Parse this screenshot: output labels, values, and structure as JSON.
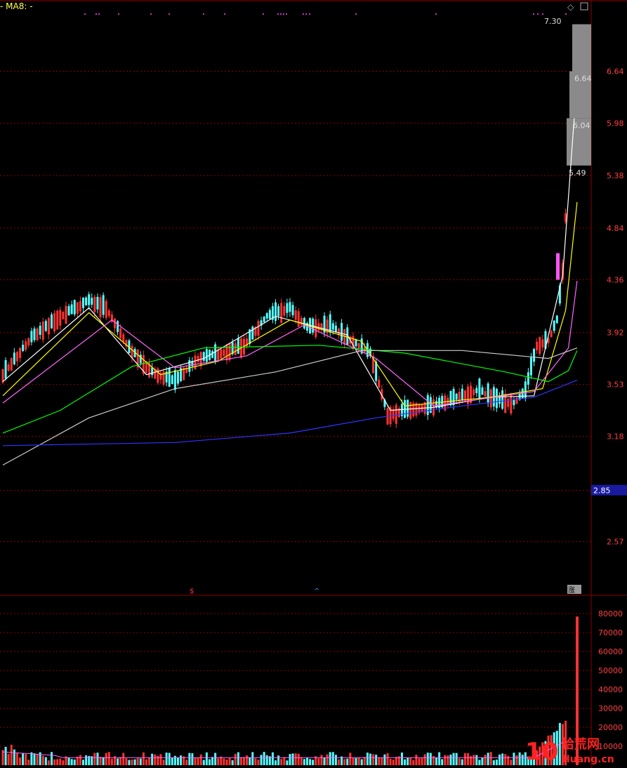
{
  "header": {
    "ma_label": "MA8:",
    "ma_value": "-",
    "left_mark": "-"
  },
  "icons": [
    "diamond-icon",
    "window-icon"
  ],
  "colors": {
    "background": "#000000",
    "up": "#ff3232",
    "down": "#54ffff",
    "grid": "#8b0000",
    "ma5": "#ffffff",
    "ma10": "#ffff00",
    "ma20": "#ff66ff",
    "ma60": "#00ff00",
    "ma120": "#cccccc",
    "ma250": "#3333ff",
    "axis_text": "#ff4040"
  },
  "chart_data": {
    "type": "candlestick",
    "price_axis": {
      "ticks": [
        "6.64",
        "5.98",
        "5.38",
        "4.84",
        "4.36",
        "3.92",
        "3.53",
        "3.18",
        "2.85",
        "2.57"
      ],
      "ylim": [
        2.4,
        7.4
      ],
      "scale": "log"
    },
    "price_tags": [
      "7.30",
      "6.64",
      "6.04",
      "5.49"
    ],
    "current_price_tag": "2.85",
    "markers": [
      "$",
      "^",
      "涨"
    ],
    "volume_axis": {
      "ticks": [
        "80000",
        "70000",
        "60000",
        "50000",
        "40000",
        "30000",
        "20000",
        "10000"
      ],
      "ylim": [
        0,
        86000
      ]
    },
    "watermark": {
      "brand": "10",
      "text": "拾荒网",
      "sub": "Huang.cn"
    },
    "profile": [
      {
        "i": 0,
        "p": 3.6
      },
      {
        "i": 10,
        "p": 3.88
      },
      {
        "i": 20,
        "p": 4.05
      },
      {
        "i": 30,
        "p": 4.18
      },
      {
        "i": 36,
        "p": 4.12
      },
      {
        "i": 44,
        "p": 3.8
      },
      {
        "i": 52,
        "p": 3.62
      },
      {
        "i": 60,
        "p": 3.55
      },
      {
        "i": 68,
        "p": 3.72
      },
      {
        "i": 76,
        "p": 3.76
      },
      {
        "i": 84,
        "p": 3.82
      },
      {
        "i": 92,
        "p": 4.05
      },
      {
        "i": 100,
        "p": 4.12
      },
      {
        "i": 106,
        "p": 3.96
      },
      {
        "i": 114,
        "p": 3.98
      },
      {
        "i": 120,
        "p": 3.88
      },
      {
        "i": 128,
        "p": 3.76
      },
      {
        "i": 134,
        "p": 3.32
      },
      {
        "i": 142,
        "p": 3.36
      },
      {
        "i": 150,
        "p": 3.38
      },
      {
        "i": 158,
        "p": 3.44
      },
      {
        "i": 166,
        "p": 3.49
      },
      {
        "i": 172,
        "p": 3.42
      },
      {
        "i": 178,
        "p": 3.4
      },
      {
        "i": 182,
        "p": 3.48
      },
      {
        "i": 186,
        "p": 3.82
      },
      {
        "i": 190,
        "p": 3.86
      },
      {
        "i": 193,
        "p": 4.02
      },
      {
        "i": 194,
        "p": 4.22
      },
      {
        "i": 195,
        "p": 4.45
      },
      {
        "i": 196,
        "p": 4.95
      },
      {
        "i": 197,
        "p": 5.49
      },
      {
        "i": 198,
        "p": 6.04
      },
      {
        "i": 199,
        "p": 6.64
      },
      {
        "i": 200,
        "p": 7.3
      }
    ],
    "ma_lines": [
      {
        "name": "ma5",
        "points": [
          [
            0,
            3.55
          ],
          [
            30,
            4.12
          ],
          [
            50,
            3.6
          ],
          [
            70,
            3.72
          ],
          [
            95,
            4.05
          ],
          [
            120,
            3.9
          ],
          [
            135,
            3.35
          ],
          [
            150,
            3.37
          ],
          [
            170,
            3.44
          ],
          [
            185,
            3.45
          ],
          [
            195,
            4.4
          ],
          [
            199,
            6.04
          ]
        ]
      },
      {
        "name": "ma10",
        "points": [
          [
            0,
            3.45
          ],
          [
            30,
            4.08
          ],
          [
            55,
            3.6
          ],
          [
            75,
            3.7
          ],
          [
            100,
            4.02
          ],
          [
            125,
            3.85
          ],
          [
            140,
            3.38
          ],
          [
            170,
            3.44
          ],
          [
            188,
            3.5
          ],
          [
            196,
            4.1
          ],
          [
            200,
            5.1
          ]
        ]
      },
      {
        "name": "ma20",
        "points": [
          [
            0,
            3.4
          ],
          [
            38,
            4.02
          ],
          [
            60,
            3.65
          ],
          [
            85,
            3.74
          ],
          [
            105,
            3.98
          ],
          [
            130,
            3.72
          ],
          [
            150,
            3.38
          ],
          [
            185,
            3.48
          ],
          [
            197,
            3.8
          ],
          [
            200,
            4.35
          ]
        ]
      },
      {
        "name": "ma60",
        "points": [
          [
            0,
            3.2
          ],
          [
            20,
            3.35
          ],
          [
            45,
            3.66
          ],
          [
            70,
            3.8
          ],
          [
            110,
            3.82
          ],
          [
            140,
            3.76
          ],
          [
            175,
            3.62
          ],
          [
            190,
            3.55
          ],
          [
            197,
            3.63
          ],
          [
            200,
            3.78
          ]
        ]
      },
      {
        "name": "ma120",
        "points": [
          [
            0,
            3.0
          ],
          [
            30,
            3.3
          ],
          [
            60,
            3.5
          ],
          [
            95,
            3.62
          ],
          [
            125,
            3.78
          ],
          [
            160,
            3.78
          ],
          [
            190,
            3.72
          ],
          [
            200,
            3.8
          ]
        ]
      },
      {
        "name": "ma250",
        "points": [
          [
            0,
            3.12
          ],
          [
            60,
            3.14
          ],
          [
            100,
            3.2
          ],
          [
            130,
            3.3
          ],
          [
            160,
            3.38
          ],
          [
            185,
            3.44
          ],
          [
            200,
            3.56
          ]
        ]
      }
    ]
  }
}
